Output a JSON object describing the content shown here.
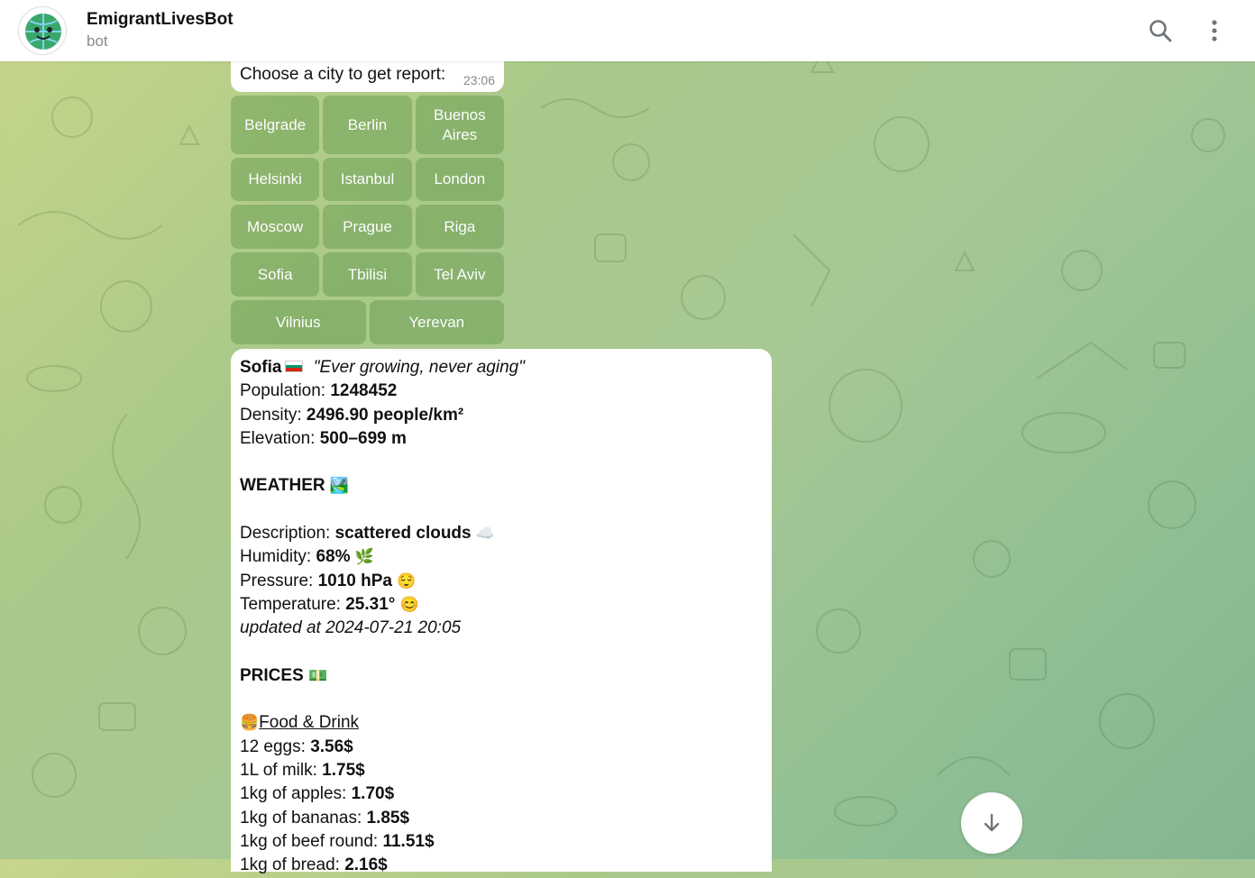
{
  "header": {
    "bot_name": "EmigrantLivesBot",
    "status": "bot",
    "avatar_icon": "globe-smiley-icon",
    "search_icon": "search-icon",
    "menu_icon": "more-vertical-icon"
  },
  "chat": {
    "prompt_text": "Choose a city to get report:",
    "prompt_time": "23:06",
    "keyboard": [
      [
        "Belgrade",
        "Berlin",
        "Buenos Aires"
      ],
      [
        "Helsinki",
        "Istanbul",
        "London"
      ],
      [
        "Moscow",
        "Prague",
        "Riga"
      ],
      [
        "Sofia",
        "Tbilisi",
        "Tel Aviv"
      ],
      [
        "Vilnius",
        "Yerevan"
      ]
    ]
  },
  "report": {
    "city": "Sofia",
    "flag": "bulgaria-flag",
    "motto": "\"Ever growing, never aging\"",
    "population_label": "Population:",
    "population_value": "1248452",
    "density_label": "Density:",
    "density_value": "2496.90 people/km²",
    "elevation_label": "Elevation:",
    "elevation_value": "500–699 m",
    "weather_heading": "WEATHER",
    "weather_icon": "🏞️",
    "description_label": "Description:",
    "description_value": "scattered clouds",
    "description_icon": "☁️",
    "humidity_label": "Humidity:",
    "humidity_value": "68%",
    "humidity_icon": "🌿",
    "pressure_label": "Pressure:",
    "pressure_value": "1010 hPa",
    "pressure_icon": "😌",
    "temperature_label": "Temperature:",
    "temperature_value": "25.31°",
    "temperature_icon": "😊",
    "updated": "updated at 2024-07-21 20:05",
    "prices_heading": "PRICES",
    "prices_icon": "💵",
    "food_icon": "🍔",
    "food_heading": "Food & Drink",
    "items": [
      {
        "label": "12 eggs:",
        "value": "3.56$"
      },
      {
        "label": "1L of milk:",
        "value": "1.75$"
      },
      {
        "label": "1kg of apples:",
        "value": "1.70$"
      },
      {
        "label": "1kg of bananas:",
        "value": "1.85$"
      },
      {
        "label": "1kg of beef round:",
        "value": "11.51$"
      },
      {
        "label": "1kg of bread:",
        "value": "2.16$"
      }
    ]
  },
  "colors": {
    "header_bg": "#ffffff",
    "keyboard_button": "#86ad6a",
    "accent_text": "#111111"
  },
  "fab_icon": "arrow-down-icon"
}
